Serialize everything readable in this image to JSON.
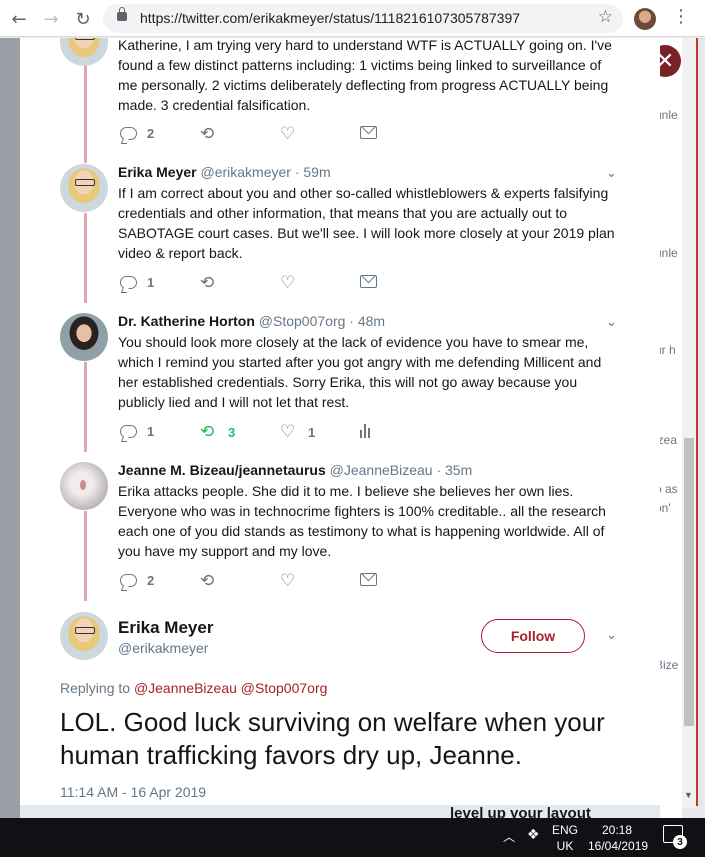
{
  "browser": {
    "url": "https://twitter.com/erikakmeyer/status/1118216107305787397",
    "back_icon": "←",
    "forward_icon": "→",
    "reload_icon": "↻",
    "star_icon": "☆",
    "menu_icon": "⋮"
  },
  "background": {
    "close_icon": "✕",
    "fragments": [
      "unle",
      "unle",
      "ur h",
      "izea",
      "o as",
      "on'",
      "Bize"
    ],
    "bottom_text": "level up your layout"
  },
  "thread": [
    {
      "name": "",
      "handle": "",
      "time": "",
      "text": "Katherine, I am trying very hard to understand WTF is ACTUALLY going on. I've found a few distinct patterns including: 1 victims being linked to surveillance of me personally. 2 victims deliberately deflecting from progress ACTUALLY being made. 3 credential falsification.",
      "replies": "2",
      "retweets": "",
      "likes": ""
    },
    {
      "name": "Erika Meyer",
      "handle": "@erikakmeyer",
      "time": "· 59m",
      "text": "If I am correct about you and other so-called whistleblowers & experts falsifying credentials and other information, that means that you are actually out to SABOTAGE court cases. But we'll see. I will look more closely at your 2019 plan video & report back.",
      "replies": "1",
      "retweets": "",
      "likes": ""
    },
    {
      "name": "Dr. Katherine Horton",
      "handle": "@Stop007org",
      "time": "· 48m",
      "text": "You should look more closely at the lack of evidence you have to smear me, which I remind you started after you got angry with me defending Millicent and her established credentials. Sorry Erika, this will not go away because you publicly lied and I will not let that rest.",
      "replies": "1",
      "retweets": "3",
      "likes": "1"
    },
    {
      "name": "Jeanne M. Bizeau/jeannetaurus",
      "handle": "@JeanneBizeau",
      "time": "· 35m",
      "text": "Erika attacks people. She did it to me. I believe she believes her own lies. Everyone who was in technocrime fighters is 100% creditable.. all the research each one of you did stands as testimony to what is happening worldwide. All of you have my support and my love.",
      "replies": "2",
      "retweets": "",
      "likes": ""
    }
  ],
  "main_tweet": {
    "name": "Erika Meyer",
    "handle": "@erikakmeyer",
    "follow_label": "Follow",
    "replying_prefix": "Replying to",
    "replying_to_1": "@JeanneBizeau",
    "replying_to_2": "@Stop007org",
    "text": "LOL. Good luck surviving on welfare when your human trafficking favors dry up, Jeanne.",
    "timestamp": "11:14 AM - 16 Apr 2019"
  },
  "taskbar": {
    "lang_line1": "ENG",
    "lang_line2": "UK",
    "time": "20:18",
    "date": "16/04/2019",
    "notifications": "3"
  },
  "colors": {
    "accent": "#a8202b",
    "retweet_active": "#17bf63",
    "thread_line": "#e0a6ab"
  }
}
